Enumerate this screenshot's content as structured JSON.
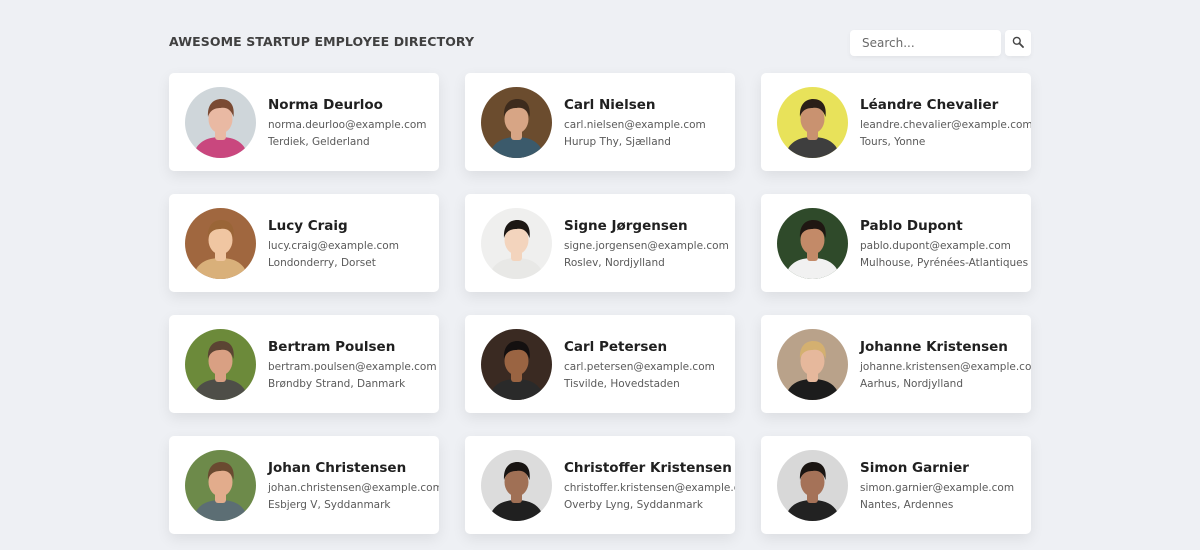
{
  "header": {
    "title": "Awesome Startup Employee Directory",
    "search_placeholder": "Search...",
    "search_icon": "magnifier-icon"
  },
  "employees": [
    {
      "name": "Norma Deurloo",
      "email": "norma.deurloo@example.com",
      "location": "Terdiek, Gelderland",
      "avatar_colors": {
        "bg": "#cfd6da",
        "skin": "#e9b9a3",
        "hair": "#7a4a33",
        "shirt": "#c9477e"
      }
    },
    {
      "name": "Carl Nielsen",
      "email": "carl.nielsen@example.com",
      "location": "Hurup Thy, Sjælland",
      "avatar_colors": {
        "bg": "#6b4c2e",
        "skin": "#d7a585",
        "hair": "#3d2b1d",
        "shirt": "#3b5a6b"
      }
    },
    {
      "name": "Léandre Chevalier",
      "email": "leandre.chevalier@example.com",
      "location": "Tours, Yonne",
      "avatar_colors": {
        "bg": "#e8e25a",
        "skin": "#c99270",
        "hair": "#2b1f18",
        "shirt": "#3e3e3e"
      }
    },
    {
      "name": "Lucy Craig",
      "email": "lucy.craig@example.com",
      "location": "Londonderry, Dorset",
      "avatar_colors": {
        "bg": "#a0673f",
        "skin": "#f0c6a2",
        "hair": "#9a6537",
        "shirt": "#d9b07a"
      }
    },
    {
      "name": "Signe Jørgensen",
      "email": "signe.jorgensen@example.com",
      "location": "Roslev, Nordjylland",
      "avatar_colors": {
        "bg": "#efefee",
        "skin": "#f3d4bd",
        "hair": "#1c1714",
        "shirt": "#e8e8e6"
      }
    },
    {
      "name": "Pablo Dupont",
      "email": "pablo.dupont@example.com",
      "location": "Mulhouse, Pyrénées-Atlantiques",
      "avatar_colors": {
        "bg": "#2f4a2a",
        "skin": "#c38a68",
        "hair": "#1f1712",
        "shirt": "#f1f1f1"
      }
    },
    {
      "name": "Bertram Poulsen",
      "email": "bertram.poulsen@example.com",
      "location": "Brøndby Strand, Danmark",
      "avatar_colors": {
        "bg": "#6c8a3a",
        "skin": "#d9a083",
        "hair": "#5b4433",
        "shirt": "#4e4e48"
      }
    },
    {
      "name": "Carl Petersen",
      "email": "carl.petersen@example.com",
      "location": "Tisvilde, Hovedstaden",
      "avatar_colors": {
        "bg": "#3a2a22",
        "skin": "#9a6442",
        "hair": "#141010",
        "shirt": "#2a2a2a"
      }
    },
    {
      "name": "Johanne Kristensen",
      "email": "johanne.kristensen@example.com",
      "location": "Aarhus, Nordjylland",
      "avatar_colors": {
        "bg": "#b9a28a",
        "skin": "#e6b89c",
        "hair": "#d4b070",
        "shirt": "#1c1c1c"
      }
    },
    {
      "name": "Johan Christensen",
      "email": "johan.christensen@example.com",
      "location": "Esbjerg V, Syddanmark",
      "avatar_colors": {
        "bg": "#6d8a4a",
        "skin": "#e2ac8c",
        "hair": "#6a4a30",
        "shirt": "#5c6e74"
      }
    },
    {
      "name": "Christoffer Kristensen",
      "email": "christoffer.kristensen@example.com",
      "location": "Overby Lyng, Syddanmark",
      "avatar_colors": {
        "bg": "#dcdcdc",
        "skin": "#a07055",
        "hair": "#181412",
        "shirt": "#202020"
      }
    },
    {
      "name": "Simon Garnier",
      "email": "simon.garnier@example.com",
      "location": "Nantes, Ardennes",
      "avatar_colors": {
        "bg": "#d8d8d8",
        "skin": "#a57258",
        "hair": "#1a1512",
        "shirt": "#222222"
      }
    }
  ]
}
